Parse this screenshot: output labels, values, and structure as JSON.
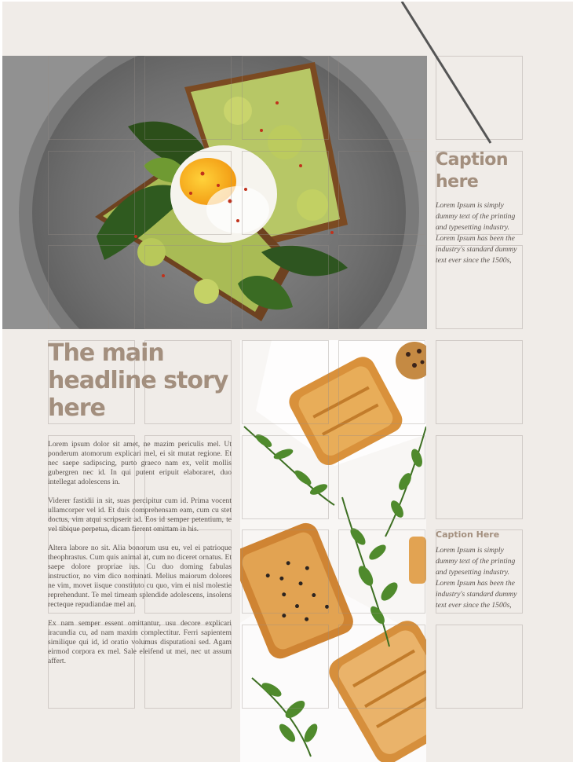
{
  "caption_top": {
    "title": "Caption here",
    "body": "Lorem Ipsum is simply dummy text of the printing and typesetting industry. Lorem Ipsum has been the industry's standard dummy text ever since the 1500s,"
  },
  "caption_bottom": {
    "title": "Caption Here",
    "body": "Lorem Ipsum is simply dummy text of the printing and typesetting industry. Lorem Ipsum has been the industry's standard dummy text ever since the 1500s,"
  },
  "headline": "The main headline story here",
  "article": {
    "paragraphs": [
      "Lorem ipsum dolor sit amet, ne mazim periculis mel. Ut ponderum atomorum explicari mel, ei sit mutat regione. Et nec saepe sadipscing, purto graeco nam ex, velit mollis gubergren nec id. In qui putent eripuit elaboraret, duo intellegat adolescens in.",
      "Viderer fastidii in sit, suas percipitur cum id. Prima vocent ullamcorper vel id. Et duis comprehensam eam, cum cu stet doctus, vim atqui scripserit ad. Eos id semper petentium, te vel tibique perpetua, dicam fierent omittam in his.",
      "Altera labore no sit. Alia bonorum usu eu, vel ei patrioque theophrastus. Cum quis animal at, cum no diceret ornatus. Et saepe dolore propriae ius. Cu duo doming fabulas instructior, no vim dico nominati. Melius maiorum dolores ne vim, movet iisque constituto cu quo, vim ei nisl molestie reprehendunt. Te mel timeam splendide adolescens, insolens recteque repudiandae mel an.",
      "Ex nam semper essent omittantur, usu decore explicari iracundia cu, ad nam maxim complectitur. Ferri sapientem similique qui id, id oratio volumus disputationi sed. Agam eirmod corpora ex mel. Sale eleifend ut mei, nec ut assum affert."
    ]
  },
  "colors": {
    "page_background": "#f0ece8",
    "accent_headline": "#a38f7e",
    "body_text": "#59514c"
  },
  "images": {
    "top_photo": "avocado-toast-poached-egg-photo",
    "right_photo": "pastries-with-herbs-photo"
  }
}
